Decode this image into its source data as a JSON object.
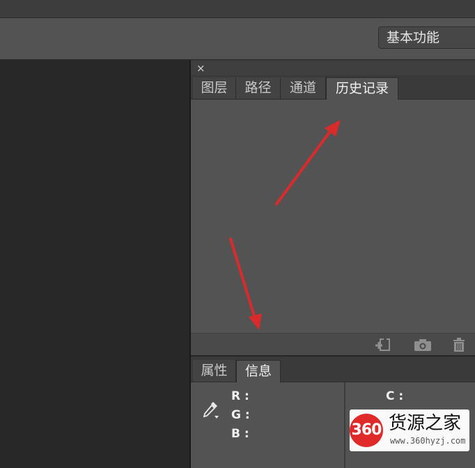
{
  "options_bar": {
    "workspace_label": "基本功能"
  },
  "dock": {
    "close_glyph": "×",
    "top_tabs": [
      {
        "label": "图层"
      },
      {
        "label": "路径"
      },
      {
        "label": "通道"
      },
      {
        "label": "历史记录",
        "active": true
      }
    ],
    "history_footer_icons": [
      "new-document-from-state-icon",
      "camera-icon",
      "trash-icon"
    ],
    "bottom_tabs": [
      {
        "label": "属性"
      },
      {
        "label": "信息",
        "active": true
      }
    ],
    "info": {
      "left_labels": {
        "r": "R :",
        "g": "G :",
        "b": "B :"
      },
      "right_labels": {
        "c": "C :"
      },
      "eyedropper_icon": "eyedropper-icon"
    }
  },
  "watermark": {
    "logo_text": "360",
    "title": "货源之家",
    "url": "www.360hyzj.com"
  },
  "annotation_colors": {
    "arrow": "#d92b2b"
  }
}
